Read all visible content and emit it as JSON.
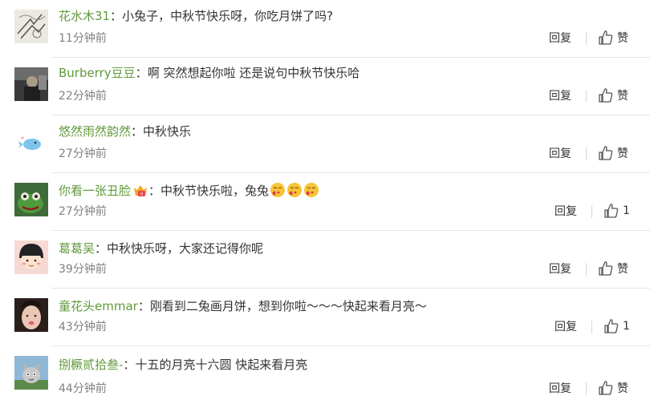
{
  "comments": [
    {
      "username": "花水木31",
      "text": "小兔子，中秋节快乐呀，你吃月饼了吗?",
      "time": "11分钟前",
      "reply": "回复",
      "like": "赞",
      "avatar": "sketch-avatar"
    },
    {
      "username": "Burberry豆豆",
      "text": "啊 突然想起你啦 还是说句中秋节快乐哈",
      "time": "22分钟前",
      "reply": "回复",
      "like": "赞",
      "avatar": "photo-avatar"
    },
    {
      "username": "悠然雨然韵然",
      "text": "中秋快乐",
      "time": "27分钟前",
      "reply": "回复",
      "like": "赞",
      "avatar": "bird-avatar"
    },
    {
      "username": "你看一张丑脸",
      "text": "中秋节快乐啦，兔兔",
      "time": "27分钟前",
      "reply": "回复",
      "like": "1",
      "avatar": "frog-avatar"
    },
    {
      "username": "葛葛吴",
      "text": "中秋快乐呀，大家还记得你呢",
      "time": "39分钟前",
      "reply": "回复",
      "like": "赞",
      "avatar": "cartoon-girl-avatar"
    },
    {
      "username": "童花头emmar",
      "text": "刚看到二兔画月饼，想到你啦～～～快起来看月亮～",
      "time": "43分钟前",
      "reply": "回复",
      "like": "1",
      "avatar": "girl-avatar"
    },
    {
      "username": "捌橛贰拾叁-",
      "text": "十五的月亮十六圆  快起来看月亮",
      "time": "44分钟前",
      "reply": "回复",
      "like": "赞",
      "avatar": "cat-avatar"
    }
  ],
  "colon": "："
}
